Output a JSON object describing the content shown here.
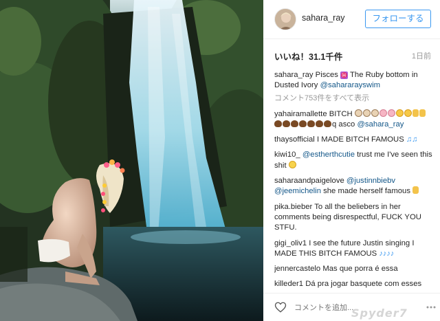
{
  "post": {
    "username": "sahara_ray",
    "follow_label": "フォローする",
    "likes": "いいね！31.1千件",
    "time": "1日前",
    "view_all_comments": "コメント753件をすべて表示",
    "add_comment_placeholder": "コメントを追加...",
    "watermark": "Spyder7",
    "caption": {
      "user": "sahara_ray",
      "text": " Pisces ",
      "text2": " The Ruby bottom in Dusted Ivory ",
      "mention": "@sahararayswim"
    },
    "comments": [
      {
        "user": "yahairamallette",
        "text": " BITCH ",
        "tail": "q asco ",
        "mention": "@sahara_ray"
      },
      {
        "user": "thaysofficial",
        "text": " I MADE BITCH FAMOUS "
      },
      {
        "user": "kiwi10_",
        "mention": " @estherthcutie",
        "text": " trust me I've seen this shit "
      },
      {
        "user": "saharaandpaigelove",
        "mention": " @justinnbiebv",
        "mention2": "@jeemichelin",
        "text": " she made herself famous "
      },
      {
        "user": "pika.bieber",
        "text": " To all the beliebers in her comments being disrespectful, FUCK YOU STFU."
      },
      {
        "user": "gigi_oliv1",
        "text": " I see the future Justin singing I MADE THIS BITCH FAMOUS "
      },
      {
        "user": "jennercastelo",
        "text": " Mas que porra é essa"
      },
      {
        "user": "killeder1",
        "text": " Dá pra jogar basquete com esses"
      }
    ]
  },
  "icons": {
    "heart": "heart-icon",
    "more": "more-options-icon"
  },
  "colors": {
    "link": "#3897f0",
    "mention": "#125688",
    "meta": "#999999"
  }
}
